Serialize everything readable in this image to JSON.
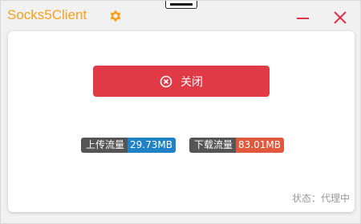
{
  "window": {
    "title": "Socks5Client",
    "icons": {
      "settings": "gear-icon",
      "minimize": "minimize-icon",
      "close": "close-icon"
    },
    "accent_color": "#f2a21c",
    "control_color": "#e0344a"
  },
  "main": {
    "action_button": {
      "label": "关闭",
      "icon": "close-circle-icon",
      "color": "#e13a47"
    },
    "upload": {
      "label": "上传流量",
      "value": "29.73MB",
      "color": "#1f82c4"
    },
    "download": {
      "label": "下载流量",
      "value": "83.01MB",
      "color": "#e0593d"
    },
    "status": "状态：代理中"
  }
}
